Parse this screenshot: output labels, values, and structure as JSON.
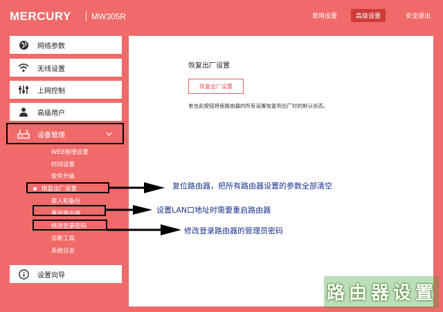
{
  "header": {
    "brand": "MERCURY",
    "model": "MW305R",
    "nav": [
      {
        "label": "常用设置",
        "active": false
      },
      {
        "label": "高级设置",
        "active": true
      },
      {
        "label": "安全退出",
        "active": false
      }
    ]
  },
  "sidebar": {
    "menus": [
      {
        "label": "网络参数",
        "icon": "globe-icon"
      },
      {
        "label": "无线设置",
        "icon": "wifi-icon"
      },
      {
        "label": "上网控制",
        "icon": "sliders-icon"
      },
      {
        "label": "高级用户",
        "icon": "user-icon"
      },
      {
        "label": "设备管理",
        "icon": "router-icon",
        "expanded": true
      }
    ],
    "submenu": [
      "WEB管理设置",
      "时间设置",
      "软件升级",
      "恢复出厂设置",
      "载入和备份",
      "重启路由器",
      "修改登录密码",
      "诊断工具",
      "系统日志"
    ],
    "selected_submenu": "恢复出厂设置",
    "bottom_menu": {
      "label": "设置向导",
      "icon": "info-icon"
    }
  },
  "content": {
    "title": "恢复出厂设置",
    "button_label": "恢复出厂设置",
    "description": "单击此按钮将使路由器的所有设置恢复到出厂时的默认状态。"
  },
  "annotations": [
    "复位路由器，把所有路由器设置的参数全部清空",
    "设置LAN口地址时需要重启路由器",
    "修改登录路由器的管理员密码"
  ],
  "watermark": "路由器设置",
  "colors": {
    "accent": "#f06a6a",
    "nav_active": "#cf3a3a",
    "annotation": "#1a2f8a"
  }
}
